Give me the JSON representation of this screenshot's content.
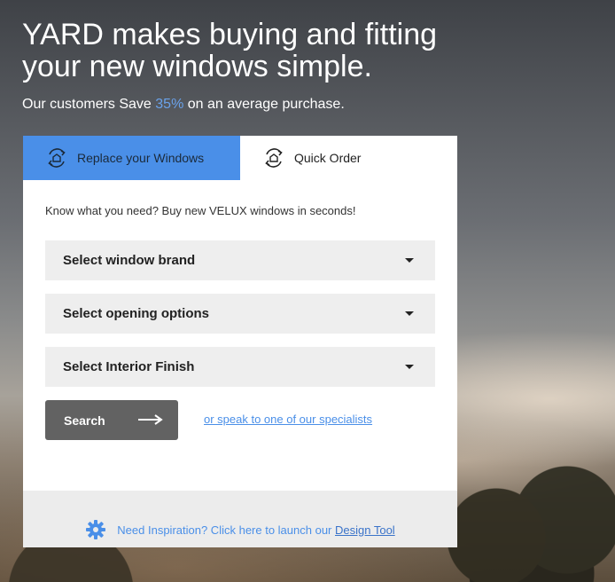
{
  "hero": {
    "headline": "YARD makes buying and fitting your new windows simple.",
    "sub_before": "Our customers Save ",
    "sub_accent": "35%",
    "sub_after": " on an average purchase."
  },
  "tabs": [
    {
      "label": "Replace your Windows",
      "icon": "window-replace-icon",
      "active": true
    },
    {
      "label": "Quick Order",
      "icon": "quick-order-icon",
      "active": false
    }
  ],
  "form": {
    "intro": "Know what you need? Buy new VELUX windows in seconds!",
    "selects": [
      {
        "label": "Select window brand"
      },
      {
        "label": "Select opening options"
      },
      {
        "label": "Select Interior Finish"
      }
    ],
    "search_label": "Search",
    "specialist_link": "or speak to one of our specialists"
  },
  "footer": {
    "icon": "gear-icon",
    "text": "Need Inspiration? Click here to launch our ",
    "link": "Design Tool"
  },
  "colors": {
    "accent": "#4a8fe8",
    "button": "#626262",
    "select_bg": "#eeeeee"
  }
}
